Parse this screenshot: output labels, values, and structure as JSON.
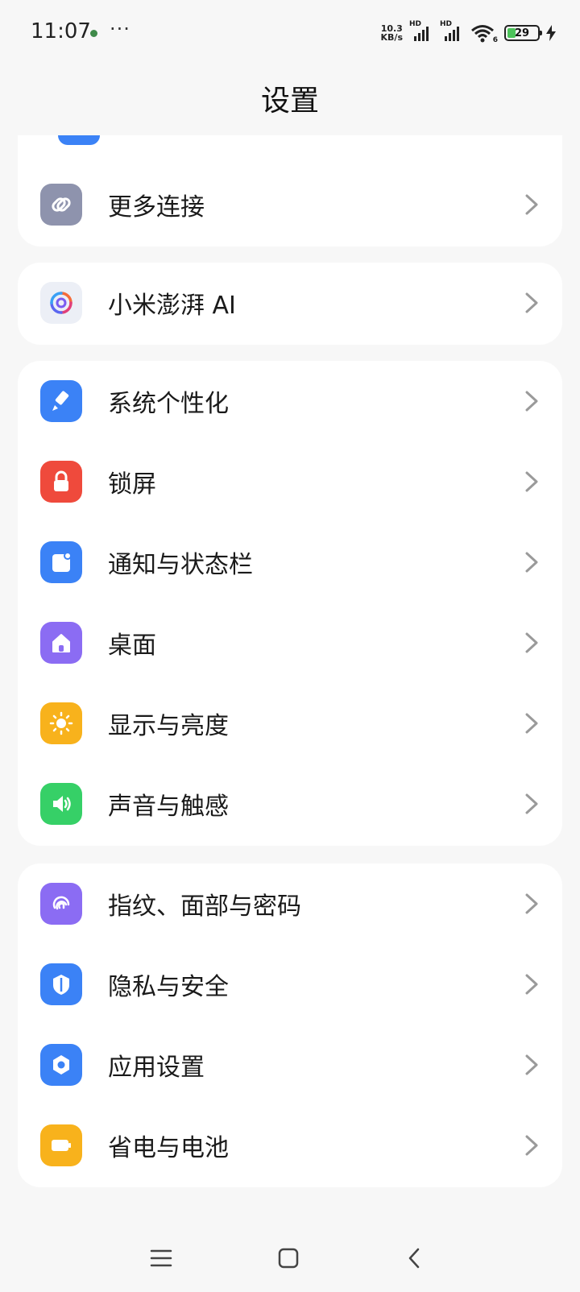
{
  "status_bar": {
    "time": "11:07",
    "more_dots": "···",
    "net_speed_value": "10.3",
    "net_speed_unit": "KB/s",
    "sim1_tag": "HD",
    "sim2_tag": "HD",
    "wifi_tag": "6",
    "battery_level": "29",
    "battery_fill_percent": 29,
    "colors": {
      "battery_fill": "#4cc35a",
      "dot": "#3f8a4a"
    }
  },
  "header": {
    "title": "设置"
  },
  "groups": [
    {
      "items": [
        {
          "label": "更多连接",
          "icon": "link-icon",
          "color": "#8e93ad"
        }
      ]
    },
    {
      "items": [
        {
          "label": "小米澎湃 AI",
          "icon": "hyperai-swirl-icon",
          "color": "#eceff6"
        }
      ]
    },
    {
      "items": [
        {
          "label": "系统个性化",
          "icon": "brush-icon",
          "color": "#3b82f6"
        },
        {
          "label": "锁屏",
          "icon": "lock-icon",
          "color": "#ef4a3c"
        },
        {
          "label": "通知与状态栏",
          "icon": "notification-icon",
          "color": "#3b82f6"
        },
        {
          "label": "桌面",
          "icon": "home-icon",
          "color": "#8b6cf3"
        },
        {
          "label": "显示与亮度",
          "icon": "sun-icon",
          "color": "#f8b21c"
        },
        {
          "label": "声音与触感",
          "icon": "speaker-icon",
          "color": "#36d067"
        }
      ]
    },
    {
      "items": [
        {
          "label": "指纹、面部与密码",
          "icon": "fingerprint-icon",
          "color": "#8b6cf3"
        },
        {
          "label": "隐私与安全",
          "icon": "privacy-shield-icon",
          "color": "#3b82f6"
        },
        {
          "label": "应用设置",
          "icon": "hexagon-gear-icon",
          "color": "#3b82f6"
        },
        {
          "label": "省电与电池",
          "icon": "battery-icon",
          "color": "#f8b21c"
        }
      ]
    }
  ],
  "nav_bar": {
    "icons": [
      "menu-icon",
      "home-square-icon",
      "back-icon"
    ]
  }
}
